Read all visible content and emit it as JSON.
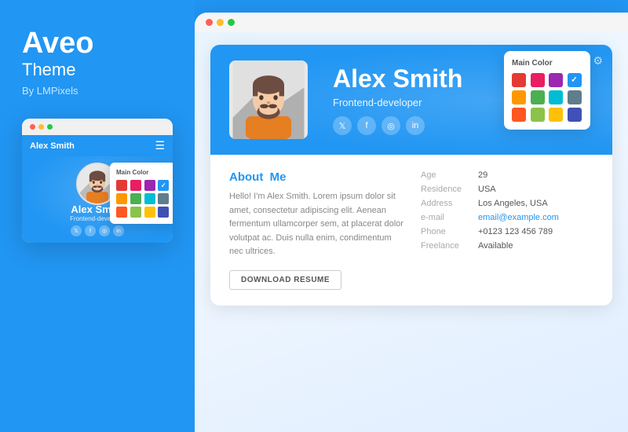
{
  "brand": {
    "title": "Aveo",
    "subtitle": "Theme",
    "by": "By LMPixels"
  },
  "mini_browser": {
    "dots": [
      "red",
      "yellow",
      "green"
    ],
    "nav_name": "Alex Smith",
    "hero_name": "Alex Smith",
    "hero_role": "Frontend-developer"
  },
  "main_browser": {
    "dots": [
      "red",
      "yellow",
      "green"
    ],
    "hero": {
      "name": "Alex Smith",
      "role": "Frontend-developer",
      "social": [
        "𝕏",
        "f",
        "◎",
        "in"
      ]
    },
    "about": {
      "title_prefix": "About",
      "title_highlight": "Me",
      "body": "Hello! I'm Alex Smith. Lorem ipsum dolor sit amet, consectetur adipiscing elit. Aenean fermentum ullamcorper sem, at placerat dolor volutpat ac. Duis nulla enim, condimentum nec ultrices.",
      "download_label": "DOWNLOAD RESUME"
    },
    "info": {
      "rows": [
        {
          "label": "Age",
          "value": "29",
          "link": false
        },
        {
          "label": "Residence",
          "value": "USA",
          "link": false
        },
        {
          "label": "Address",
          "value": "Los Angeles, USA",
          "link": false
        },
        {
          "label": "e-mail",
          "value": "email@example.com",
          "link": true
        },
        {
          "label": "Phone",
          "value": "+0123 123 456 789",
          "link": false
        },
        {
          "label": "Freelance",
          "value": "Available",
          "link": false
        }
      ]
    }
  },
  "color_swatches": {
    "main_label": "Main Color",
    "colors": [
      "#e53935",
      "#e91e63",
      "#9c27b0",
      "#2196F3",
      "#ff9800",
      "#4caf50",
      "#00bcd4",
      "#607d8b",
      "#ff5722",
      "#8bc34a",
      "#ffc107",
      "#3f51b5"
    ],
    "selected_index": 3
  },
  "social_icons": {
    "twitter": "𝕏",
    "facebook": "f",
    "instagram": "◎",
    "linkedin": "in"
  }
}
